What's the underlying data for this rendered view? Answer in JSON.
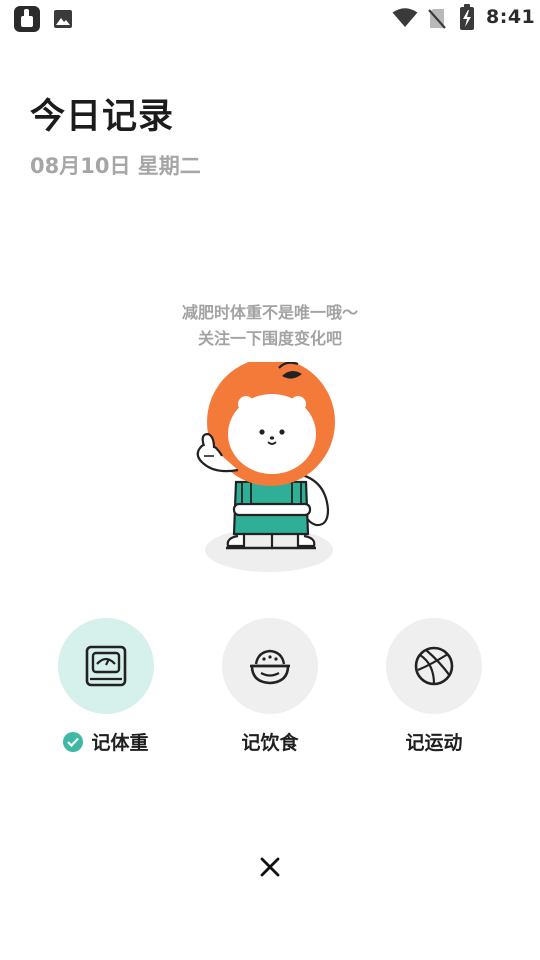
{
  "status_bar": {
    "time": "8:41",
    "icons": [
      "app-icon",
      "image-icon",
      "wifi-icon",
      "no-sim-icon",
      "battery-charging-icon"
    ]
  },
  "header": {
    "title": "今日记录",
    "date": "08月10日 星期二"
  },
  "tip": {
    "line1": "减肥时体重不是唯一哦～",
    "line2": "关注一下围度变化吧"
  },
  "actions": [
    {
      "label": "记体重",
      "icon": "scale-icon",
      "checked": true
    },
    {
      "label": "记饮食",
      "icon": "rice-bowl-icon",
      "checked": false
    },
    {
      "label": "记运动",
      "icon": "basketball-icon",
      "checked": false
    }
  ],
  "colors": {
    "accent": "#3fb8a4",
    "active_bg": "#d6f0ec",
    "mascot_orange": "#f47a3a",
    "mascot_overalls": "#2fae98"
  },
  "close": {
    "icon": "close-icon"
  }
}
